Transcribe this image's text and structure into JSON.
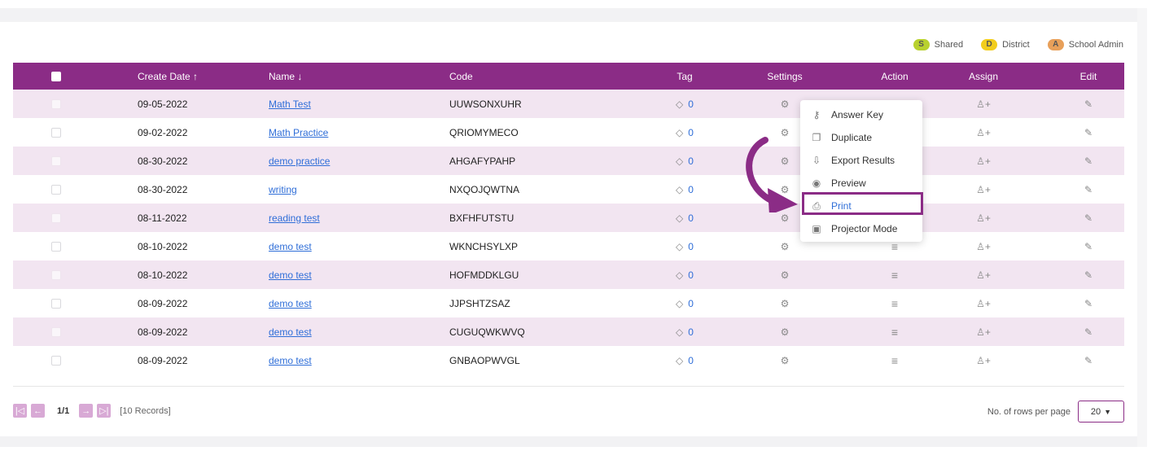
{
  "legend": [
    {
      "letter": "S",
      "label": "Shared",
      "color": "#b8d12e"
    },
    {
      "letter": "D",
      "label": "District",
      "color": "#f2cd1d"
    },
    {
      "letter": "A",
      "label": "School Admin",
      "color": "#e8a05a"
    }
  ],
  "columns": {
    "create_date": "Create Date ↑",
    "name": "Name ↓",
    "code": "Code",
    "tag": "Tag",
    "settings": "Settings",
    "action": "Action",
    "assign": "Assign",
    "edit": "Edit"
  },
  "rows": [
    {
      "date": "09-05-2022",
      "name": "Math Test",
      "code": "UUWSONXUHR",
      "tag": "0"
    },
    {
      "date": "09-02-2022",
      "name": "Math Practice",
      "code": "QRIOMYMECO",
      "tag": "0"
    },
    {
      "date": "08-30-2022",
      "name": "demo practice",
      "code": "AHGAFYPAHP",
      "tag": "0"
    },
    {
      "date": "08-30-2022",
      "name": "writing",
      "code": "NXQOJQWTNA",
      "tag": "0"
    },
    {
      "date": "08-11-2022",
      "name": "reading test",
      "code": "BXFHFUTSTU",
      "tag": "0"
    },
    {
      "date": "08-10-2022",
      "name": "demo test",
      "code": "WKNCHSYLXP",
      "tag": "0"
    },
    {
      "date": "08-10-2022",
      "name": "demo test",
      "code": "HOFMDDKLGU",
      "tag": "0"
    },
    {
      "date": "08-09-2022",
      "name": "demo test",
      "code": "JJPSHTZSAZ",
      "tag": "0"
    },
    {
      "date": "08-09-2022",
      "name": "demo test",
      "code": "CUGUQWKWVQ",
      "tag": "0"
    },
    {
      "date": "08-09-2022",
      "name": "demo test",
      "code": "GNBAOPWVGL",
      "tag": "0"
    }
  ],
  "menu": {
    "items": [
      {
        "label": "Answer Key",
        "icon": "key-icon",
        "glyph": "⚷"
      },
      {
        "label": "Duplicate",
        "icon": "copy-icon",
        "glyph": "❐"
      },
      {
        "label": "Export Results",
        "icon": "export-icon",
        "glyph": "⇩"
      },
      {
        "label": "Preview",
        "icon": "eye-icon",
        "glyph": "◉"
      },
      {
        "label": "Print",
        "icon": "printer-icon",
        "glyph": "⎙"
      },
      {
        "label": "Projector Mode",
        "icon": "projector-icon",
        "glyph": "▣"
      }
    ]
  },
  "pagination": {
    "page": "1/1",
    "records": "[10 Records]",
    "rows_per_page_label": "No. of rows per page",
    "rows_per_page_value": "20"
  },
  "colors": {
    "header": "#8b2c86",
    "link": "#2f6ed8",
    "stripe": "#f2e5f1"
  }
}
